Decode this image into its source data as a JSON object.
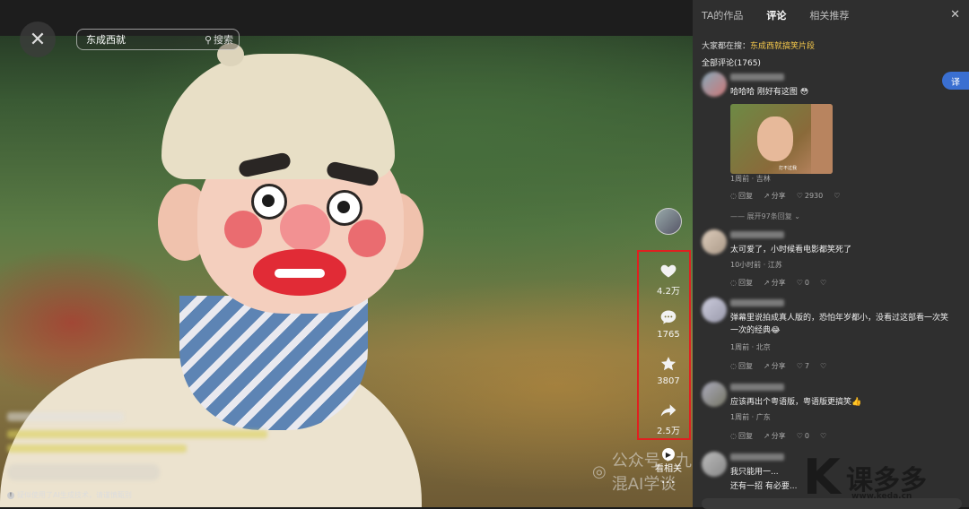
{
  "search": {
    "value": "东成西就",
    "button_label": "搜索"
  },
  "video": {
    "ai_note": "疑似使用了AI生成技术，请谨慎甄别",
    "actions": {
      "likes": "4.2万",
      "comments": "1765",
      "favorites": "3807",
      "shares": "2.5万",
      "related_label": "看相关",
      "more": "···"
    }
  },
  "panel": {
    "tabs": [
      "TA的作品",
      "评论",
      "相关推荐"
    ],
    "active_tab": "评论",
    "everyone_searching_label": "大家都在搜：",
    "everyone_searching_term": "东成西就搞笑片段",
    "comment_count_label": "全部评论(1765)",
    "translate_label": "译",
    "expand_label": "展开97条回复",
    "comments": [
      {
        "text": "哈哈哈 刚好有这图 😳",
        "meta": "1周前 · 吉林",
        "reply": "回复",
        "share": "分享",
        "likes": "2930",
        "image_caption": "打不过我"
      },
      {
        "text": "太可爱了，小时候看电影都笑死了",
        "meta": "10小时前 · 江苏",
        "reply": "回复",
        "share": "分享",
        "likes": "0"
      },
      {
        "text": "弹幕里说拍成真人版的，恐怕年岁都小，没看过这部看一次笑一次的经典😂",
        "meta": "1周前 · 北京",
        "reply": "回复",
        "share": "分享",
        "likes": "7"
      },
      {
        "text": "应该再出个粤语版，粤语版更搞笑👍",
        "meta": "1周前 · 广东",
        "reply": "回复",
        "share": "分享",
        "likes": "0"
      },
      {
        "text": "我只能用一..."
      },
      {
        "text": "还有一招 有必要..."
      }
    ]
  },
  "watermark": {
    "text": "公众号 · 九混AI学谈"
  },
  "brand": {
    "logo": "K",
    "name": "课多多",
    "url": "www.keda.cn"
  },
  "colors": {
    "accent_red": "#e02020",
    "hot_search": "#f5c84b",
    "translate_blue": "#3a6fd1"
  }
}
